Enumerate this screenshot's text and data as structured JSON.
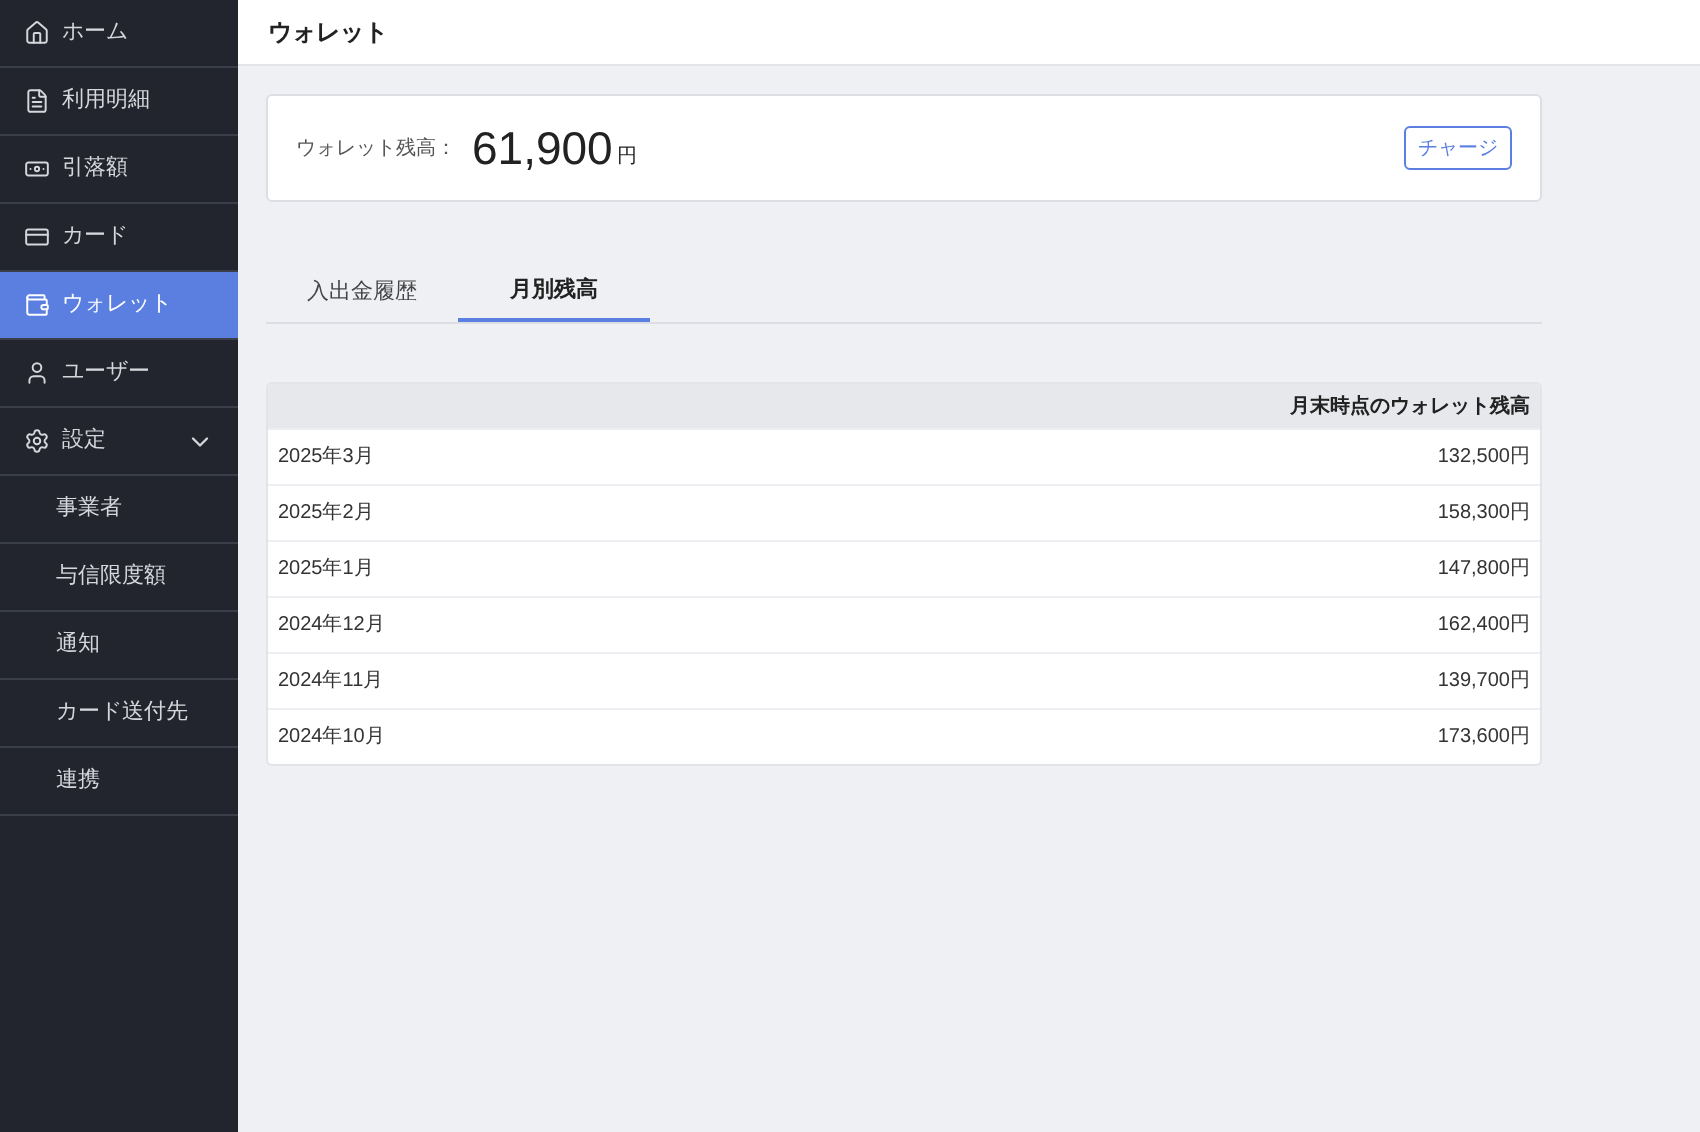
{
  "sidebar": {
    "items": [
      {
        "kind": "home",
        "label": "ホーム",
        "selected": false
      },
      {
        "kind": "statement",
        "label": "利用明細",
        "selected": false
      },
      {
        "kind": "money",
        "label": "引落額",
        "selected": false
      },
      {
        "kind": "card",
        "label": "カード",
        "selected": false
      },
      {
        "kind": "wallet",
        "label": "ウォレット",
        "selected": true
      },
      {
        "kind": "user",
        "label": "ユーザー",
        "selected": false
      },
      {
        "kind": "settings",
        "label": "設定",
        "selected": false,
        "expanded": true,
        "children": [
          {
            "label": "事業者",
            "selected": false
          },
          {
            "label": "与信限度額",
            "selected": false
          },
          {
            "label": "通知",
            "selected": false
          },
          {
            "label": "カード送付先",
            "selected": false
          },
          {
            "label": "連携",
            "selected": false
          }
        ]
      }
    ]
  },
  "header": {
    "title": "ウォレット"
  },
  "balance": {
    "label": "ウォレット残高：",
    "amount": "61,900",
    "unit": "円",
    "button": "チャージ"
  },
  "tabs": [
    {
      "label": "入出金履歴",
      "selected": false
    },
    {
      "label": "月別残高",
      "selected": true
    }
  ],
  "table": {
    "columns": [
      "月末時点のウォレット残高"
    ],
    "rows": [
      {
        "month": "2025年3月",
        "balance": "132,500円"
      },
      {
        "month": "2025年2月",
        "balance": "158,300円"
      },
      {
        "month": "2025年1月",
        "balance": "147,800円"
      },
      {
        "month": "2024年12月",
        "balance": "162,400円"
      },
      {
        "month": "2024年11月",
        "balance": "139,700円"
      },
      {
        "month": "2024年10月",
        "balance": "173,600円"
      }
    ]
  }
}
